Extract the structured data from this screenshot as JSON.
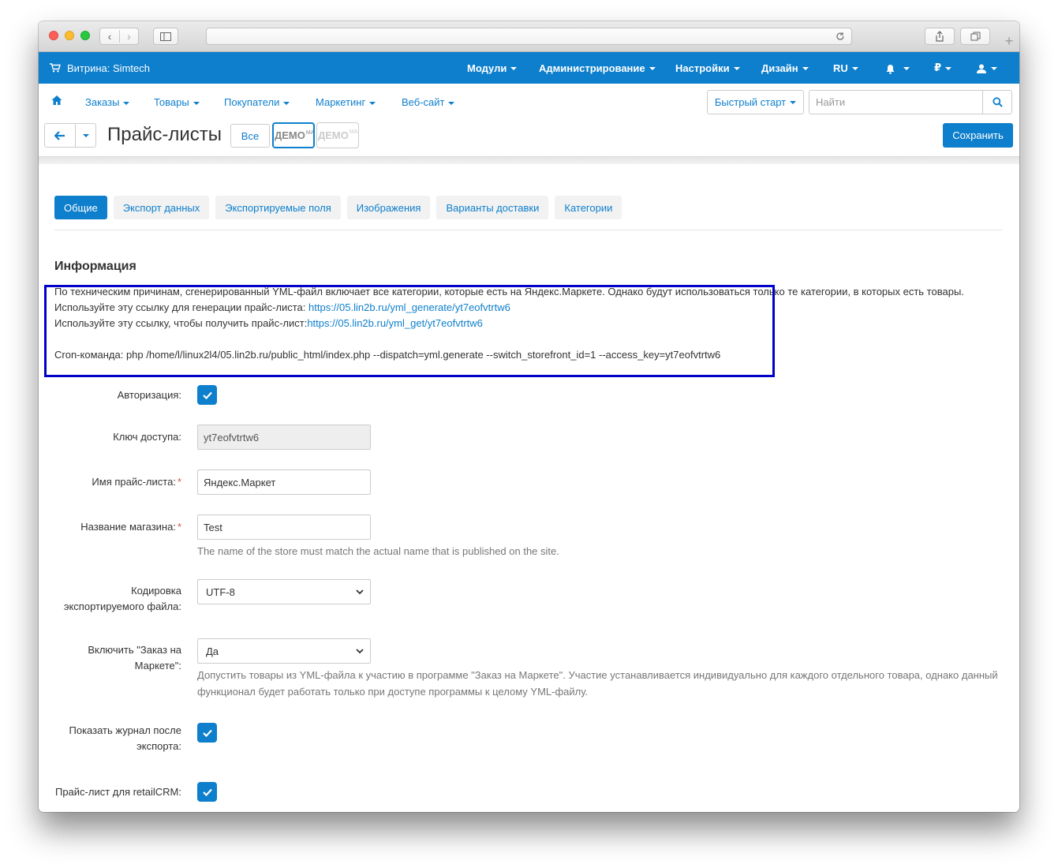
{
  "topbar": {
    "storefront": "Витрина: Simtech",
    "menu": [
      "Модули",
      "Администрирование",
      "Настройки",
      "Дизайн",
      "RU"
    ],
    "currency": "₽"
  },
  "subnav": {
    "items": [
      "Заказы",
      "Товары",
      "Покупатели",
      "Маркетинг",
      "Веб-сайт"
    ],
    "quickstart": "Быстрый старт",
    "search_placeholder": "Найти"
  },
  "title_row": {
    "title": "Прайс-листы",
    "all_label": "Все",
    "demo_label": "ДЕМО",
    "demo_suffix": "МА",
    "save_label": "Сохранить"
  },
  "tabs": [
    "Общие",
    "Экспорт данных",
    "Экспортируемые поля",
    "Изображения",
    "Варианты доставки",
    "Категории"
  ],
  "info": {
    "title": "Информация",
    "line1": "По техническим причинам, сгенерированный YML-файл включает все категории, которые есть на Яндекс.Маркете. Однако будут использоваться только те категории, в которых есть товары.",
    "line2_text": "Используйте эту ссылку для генерации прайс-листа: ",
    "line2_link": "https://05.lin2b.ru/yml_generate/yt7eofvtrtw6",
    "line3_text": "Используйте эту ссылку, чтобы получить прайс-лист:",
    "line3_link": "https://05.lin2b.ru/yml_get/yt7eofvtrtw6",
    "cron": "Cron-команда: php /home/l/linux2l4/05.lin2b.ru/public_html/index.php --dispatch=yml.generate --switch_storefront_id=1 --access_key=yt7eofvtrtw6"
  },
  "form": {
    "auth_label": "Авторизация:",
    "key_label": "Ключ доступа:",
    "key_value": "yt7eofvtrtw6",
    "pricelist_label": "Имя прайс-листа:",
    "pricelist_value": "Яндекс.Маркет",
    "shop_label": "Название магазина:",
    "shop_value": "Test",
    "shop_help": "The name of the store must match the actual name that is published on the site.",
    "encoding_label_1": "Кодировка",
    "encoding_label_2": "экспортируемого файла:",
    "encoding_value": "UTF-8",
    "order_label_1": "Включить \"Заказ на",
    "order_label_2": "Маркете\":",
    "order_value": "Да",
    "order_help_1": "Допустить товары из YML-файла к участию в программе \"Заказ на Маркете\". Участие устанавливается индивидуально для каждого отдельного товара, однако данный",
    "order_help_2": "функционал будет работать только при доступе программы к целому YML-файлу.",
    "log_label_1": "Показать журнал после",
    "log_label_2": "экспорта:",
    "retail_label": "Прайс-лист для retailCRM:"
  },
  "colors": {
    "brand": "#0e7fcc",
    "highlight": "#0000c8",
    "required": "#d9534f"
  }
}
